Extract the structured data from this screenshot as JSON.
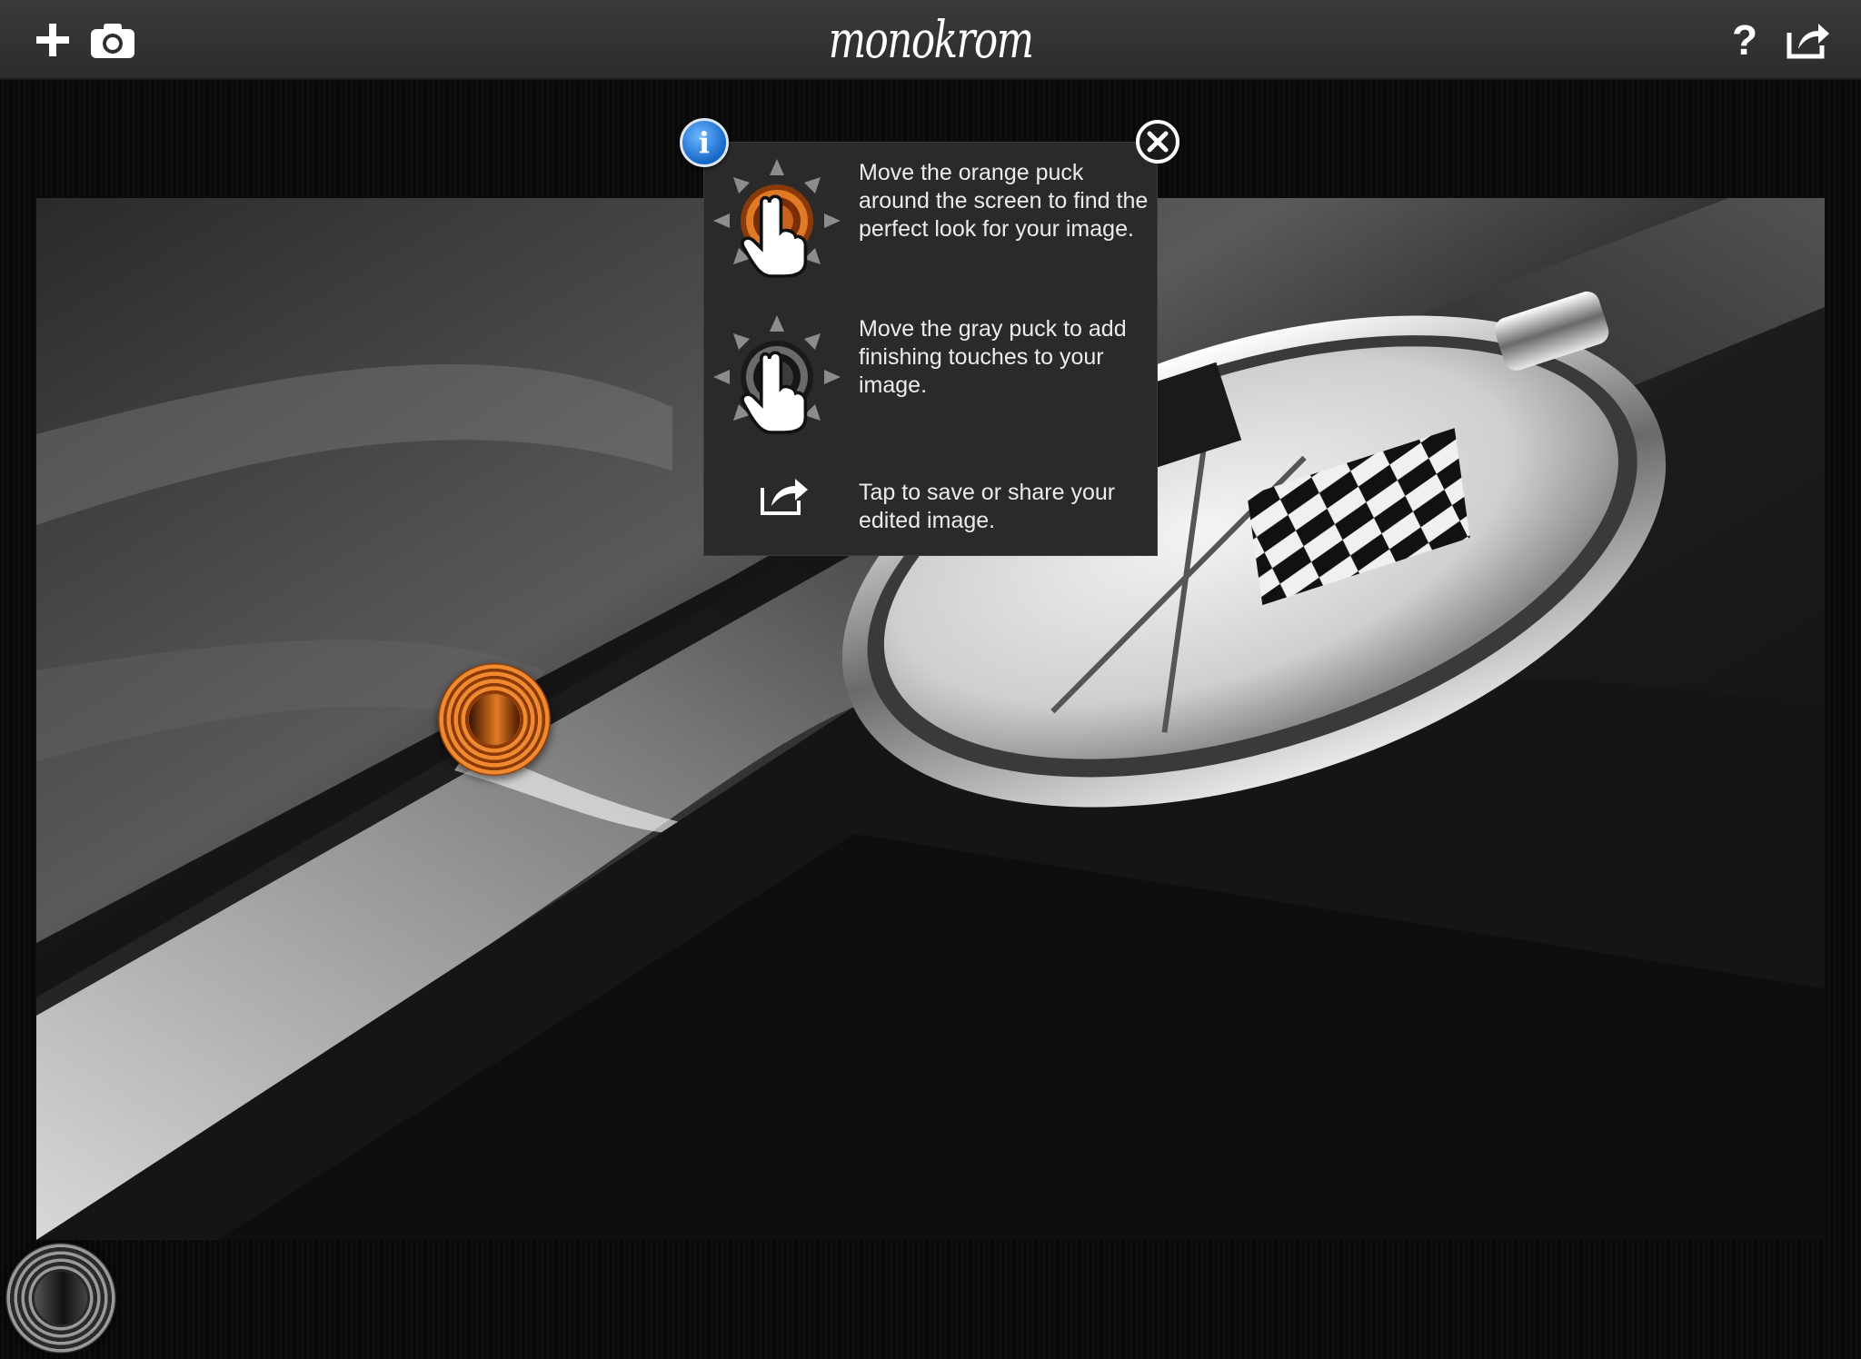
{
  "app": {
    "logo_text": "monokrom"
  },
  "toolbar": {
    "left_buttons": [
      {
        "name": "add-button",
        "icon": "plus-icon"
      },
      {
        "name": "camera-button",
        "icon": "camera-icon"
      }
    ],
    "right_buttons": [
      {
        "name": "help-button",
        "icon": "question-icon",
        "label": "?"
      },
      {
        "name": "share-button",
        "icon": "share-icon"
      }
    ]
  },
  "help_popover": {
    "info_badge": "i",
    "items": [
      {
        "icon": "orange-puck-touch-icon",
        "text": "Move the orange puck around the screen to find the perfect look for your image."
      },
      {
        "icon": "gray-puck-touch-icon",
        "text": "Move the gray puck to add finishing touches to your image."
      },
      {
        "icon": "share-icon",
        "text": "Tap to save or share your edited image."
      }
    ]
  },
  "pucks": {
    "orange": {
      "color": "#e07a24"
    },
    "gray": {
      "color": "#555555"
    }
  },
  "colors": {
    "toolbar": "#333333",
    "popover": "#2a2a2a",
    "info_blue": "#1466c8",
    "accent_orange": "#e07a24"
  }
}
